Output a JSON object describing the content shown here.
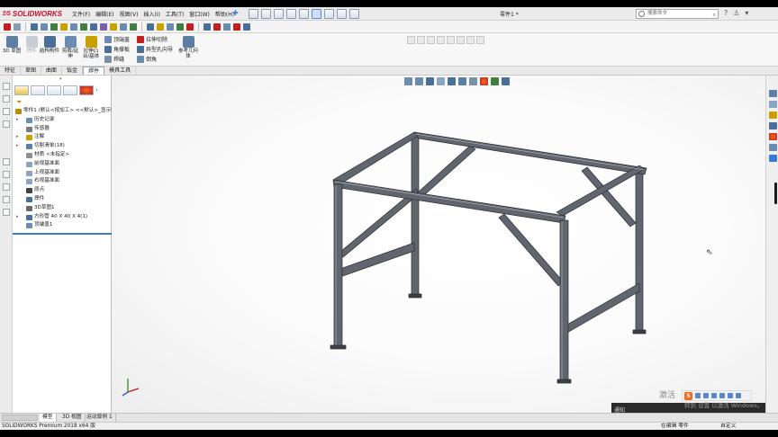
{
  "app": {
    "logo": "SOLIDWORKS",
    "document_title": "零件1 *",
    "menus": [
      "文件(F)",
      "编辑(E)",
      "视图(V)",
      "插入(I)",
      "工具(T)",
      "窗口(W)",
      "帮助(H)"
    ],
    "search_placeholder": "搜索命令",
    "top_right_icons": [
      "help-icon",
      "user-icon",
      "options-icon"
    ]
  },
  "ribbon": {
    "big_buttons": [
      {
        "label": "3D 草图",
        "icon": "3d-sketch-icon"
      },
      {
        "label": "焊件",
        "icon": "weldment-icon"
      },
      {
        "label": "结构构件",
        "icon": "structural-member-icon"
      },
      {
        "label": "剪裁/延伸",
        "icon": "trim-extend-icon"
      },
      {
        "label": "拉伸凸台/基体",
        "icon": "extrude-boss-icon"
      }
    ],
    "small_buttons_col1": [
      "顶端盖",
      "角撑板",
      "焊缝"
    ],
    "small_buttons_col2": [
      "拉伸切除",
      "异型孔向导",
      "倒角"
    ],
    "reference_button": "参考几何体"
  },
  "tabs": [
    "特征",
    "草图",
    "曲面",
    "钣金",
    "焊件",
    "模具工具"
  ],
  "active_tab": "焊件",
  "feature_tree": [
    {
      "label": "零件1 (默认<按加工> <<默认>_显示状",
      "indent": 0,
      "expander": false,
      "icon": "part-icon",
      "color": "#c08a00"
    },
    {
      "label": "历史记录",
      "indent": 1,
      "expander": true,
      "icon": "history-icon",
      "color": "#6d8fb5"
    },
    {
      "label": "传感器",
      "indent": 1,
      "expander": false,
      "icon": "sensor-icon",
      "color": "#7a7a7a"
    },
    {
      "label": "注解",
      "indent": 1,
      "expander": true,
      "icon": "annotation-icon",
      "color": "#c8a000"
    },
    {
      "label": "切割清单(18)",
      "indent": 1,
      "expander": true,
      "icon": "cut-list-icon",
      "color": "#5b7fa8"
    },
    {
      "label": "材质 <未指定>",
      "indent": 1,
      "expander": false,
      "icon": "material-icon",
      "color": "#8f8f8f"
    },
    {
      "label": "前视基准面",
      "indent": 1,
      "expander": false,
      "icon": "plane-icon",
      "color": "#8aa4c4"
    },
    {
      "label": "上视基准面",
      "indent": 1,
      "expander": false,
      "icon": "plane-icon",
      "color": "#8aa4c4"
    },
    {
      "label": "右视基准面",
      "indent": 1,
      "expander": false,
      "icon": "plane-icon",
      "color": "#8aa4c4"
    },
    {
      "label": "原点",
      "indent": 1,
      "expander": false,
      "icon": "origin-icon",
      "color": "#444444"
    },
    {
      "label": "焊件",
      "indent": 1,
      "expander": false,
      "icon": "weldment-icon",
      "color": "#4a6f9a"
    },
    {
      "label": "3D草图1",
      "indent": 1,
      "expander": false,
      "icon": "3d-sketch-icon",
      "color": "#6a6a6a"
    },
    {
      "label": "方形管 40 X 40 X 4(1)",
      "indent": 1,
      "expander": true,
      "icon": "structural-member-icon",
      "color": "#4a6f9a"
    },
    {
      "label": "顶端盖1",
      "indent": 1,
      "expander": false,
      "icon": "end-cap-icon",
      "color": "#6b8cb0"
    }
  ],
  "bottom_tabs": [
    "模型",
    "3D 视图",
    "运动算例 1"
  ],
  "active_bottom_tab": "模型",
  "status": {
    "left": "SOLIDWORKS Premium 2018 x64 版",
    "mode": "在编辑 零件",
    "units": "自定义"
  },
  "overlay": {
    "activate_title": "激活",
    "activate_hint": "转到 设置 以激活 Windows。",
    "notify": "通知",
    "ime_brand": "S"
  },
  "colors": {
    "accent": "#3b7bd8",
    "brand": "#c8102e",
    "frame": "#5a5d66"
  }
}
